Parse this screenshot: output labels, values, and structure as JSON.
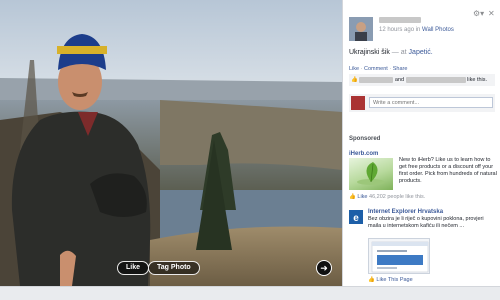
{
  "photo": {
    "like_label": "Like",
    "tag_label": "Tag Photo"
  },
  "post": {
    "time": "12 hours ago",
    "in_label": "in",
    "album": "Wall Photos",
    "caption": "Ukrajinski šik",
    "at_label": "— at",
    "location": "Japetić."
  },
  "actions": {
    "like": "Like",
    "sep1": " · ",
    "comment": "Comment",
    "sep2": " · ",
    "share": "Share"
  },
  "likes": {
    "and_label": "and",
    "suffix": "like this."
  },
  "comment": {
    "placeholder": "Write a comment..."
  },
  "sponsored": {
    "label": "Sponsored",
    "ad1": {
      "title": "iHerb.com",
      "body": "New to iHerb? Like us to learn how to get free products or a discount off your first order. Pick from hundreds of natural products.",
      "like_label": "Like",
      "likes_count": "46,202 people like this."
    },
    "ad2": {
      "title": "Internet Explorer Hrvatska",
      "body": "Bez obzira je li riječ o kupovini poklona, provjeri maila u internetskom kafiću ili nečem ...",
      "like_page": "Like This Page"
    }
  },
  "icons": {
    "gear": "gear-icon",
    "close": "close-icon",
    "next": "chevron-right-icon",
    "thumb": "thumbs-up-icon"
  },
  "colors": {
    "link": "#3b5998",
    "panel_bg": "#f2f3f5"
  }
}
